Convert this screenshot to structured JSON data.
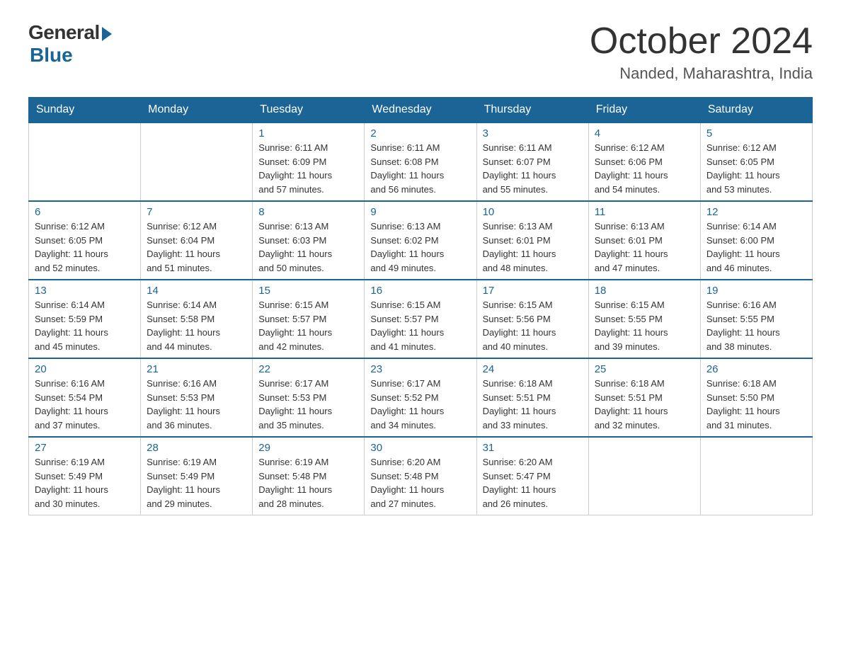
{
  "header": {
    "logo_general": "General",
    "logo_blue": "Blue",
    "title": "October 2024",
    "subtitle": "Nanded, Maharashtra, India"
  },
  "days_of_week": [
    "Sunday",
    "Monday",
    "Tuesday",
    "Wednesday",
    "Thursday",
    "Friday",
    "Saturday"
  ],
  "weeks": [
    [
      {
        "day": "",
        "info": ""
      },
      {
        "day": "",
        "info": ""
      },
      {
        "day": "1",
        "info": "Sunrise: 6:11 AM\nSunset: 6:09 PM\nDaylight: 11 hours\nand 57 minutes."
      },
      {
        "day": "2",
        "info": "Sunrise: 6:11 AM\nSunset: 6:08 PM\nDaylight: 11 hours\nand 56 minutes."
      },
      {
        "day": "3",
        "info": "Sunrise: 6:11 AM\nSunset: 6:07 PM\nDaylight: 11 hours\nand 55 minutes."
      },
      {
        "day": "4",
        "info": "Sunrise: 6:12 AM\nSunset: 6:06 PM\nDaylight: 11 hours\nand 54 minutes."
      },
      {
        "day": "5",
        "info": "Sunrise: 6:12 AM\nSunset: 6:05 PM\nDaylight: 11 hours\nand 53 minutes."
      }
    ],
    [
      {
        "day": "6",
        "info": "Sunrise: 6:12 AM\nSunset: 6:05 PM\nDaylight: 11 hours\nand 52 minutes."
      },
      {
        "day": "7",
        "info": "Sunrise: 6:12 AM\nSunset: 6:04 PM\nDaylight: 11 hours\nand 51 minutes."
      },
      {
        "day": "8",
        "info": "Sunrise: 6:13 AM\nSunset: 6:03 PM\nDaylight: 11 hours\nand 50 minutes."
      },
      {
        "day": "9",
        "info": "Sunrise: 6:13 AM\nSunset: 6:02 PM\nDaylight: 11 hours\nand 49 minutes."
      },
      {
        "day": "10",
        "info": "Sunrise: 6:13 AM\nSunset: 6:01 PM\nDaylight: 11 hours\nand 48 minutes."
      },
      {
        "day": "11",
        "info": "Sunrise: 6:13 AM\nSunset: 6:01 PM\nDaylight: 11 hours\nand 47 minutes."
      },
      {
        "day": "12",
        "info": "Sunrise: 6:14 AM\nSunset: 6:00 PM\nDaylight: 11 hours\nand 46 minutes."
      }
    ],
    [
      {
        "day": "13",
        "info": "Sunrise: 6:14 AM\nSunset: 5:59 PM\nDaylight: 11 hours\nand 45 minutes."
      },
      {
        "day": "14",
        "info": "Sunrise: 6:14 AM\nSunset: 5:58 PM\nDaylight: 11 hours\nand 44 minutes."
      },
      {
        "day": "15",
        "info": "Sunrise: 6:15 AM\nSunset: 5:57 PM\nDaylight: 11 hours\nand 42 minutes."
      },
      {
        "day": "16",
        "info": "Sunrise: 6:15 AM\nSunset: 5:57 PM\nDaylight: 11 hours\nand 41 minutes."
      },
      {
        "day": "17",
        "info": "Sunrise: 6:15 AM\nSunset: 5:56 PM\nDaylight: 11 hours\nand 40 minutes."
      },
      {
        "day": "18",
        "info": "Sunrise: 6:15 AM\nSunset: 5:55 PM\nDaylight: 11 hours\nand 39 minutes."
      },
      {
        "day": "19",
        "info": "Sunrise: 6:16 AM\nSunset: 5:55 PM\nDaylight: 11 hours\nand 38 minutes."
      }
    ],
    [
      {
        "day": "20",
        "info": "Sunrise: 6:16 AM\nSunset: 5:54 PM\nDaylight: 11 hours\nand 37 minutes."
      },
      {
        "day": "21",
        "info": "Sunrise: 6:16 AM\nSunset: 5:53 PM\nDaylight: 11 hours\nand 36 minutes."
      },
      {
        "day": "22",
        "info": "Sunrise: 6:17 AM\nSunset: 5:53 PM\nDaylight: 11 hours\nand 35 minutes."
      },
      {
        "day": "23",
        "info": "Sunrise: 6:17 AM\nSunset: 5:52 PM\nDaylight: 11 hours\nand 34 minutes."
      },
      {
        "day": "24",
        "info": "Sunrise: 6:18 AM\nSunset: 5:51 PM\nDaylight: 11 hours\nand 33 minutes."
      },
      {
        "day": "25",
        "info": "Sunrise: 6:18 AM\nSunset: 5:51 PM\nDaylight: 11 hours\nand 32 minutes."
      },
      {
        "day": "26",
        "info": "Sunrise: 6:18 AM\nSunset: 5:50 PM\nDaylight: 11 hours\nand 31 minutes."
      }
    ],
    [
      {
        "day": "27",
        "info": "Sunrise: 6:19 AM\nSunset: 5:49 PM\nDaylight: 11 hours\nand 30 minutes."
      },
      {
        "day": "28",
        "info": "Sunrise: 6:19 AM\nSunset: 5:49 PM\nDaylight: 11 hours\nand 29 minutes."
      },
      {
        "day": "29",
        "info": "Sunrise: 6:19 AM\nSunset: 5:48 PM\nDaylight: 11 hours\nand 28 minutes."
      },
      {
        "day": "30",
        "info": "Sunrise: 6:20 AM\nSunset: 5:48 PM\nDaylight: 11 hours\nand 27 minutes."
      },
      {
        "day": "31",
        "info": "Sunrise: 6:20 AM\nSunset: 5:47 PM\nDaylight: 11 hours\nand 26 minutes."
      },
      {
        "day": "",
        "info": ""
      },
      {
        "day": "",
        "info": ""
      }
    ]
  ]
}
